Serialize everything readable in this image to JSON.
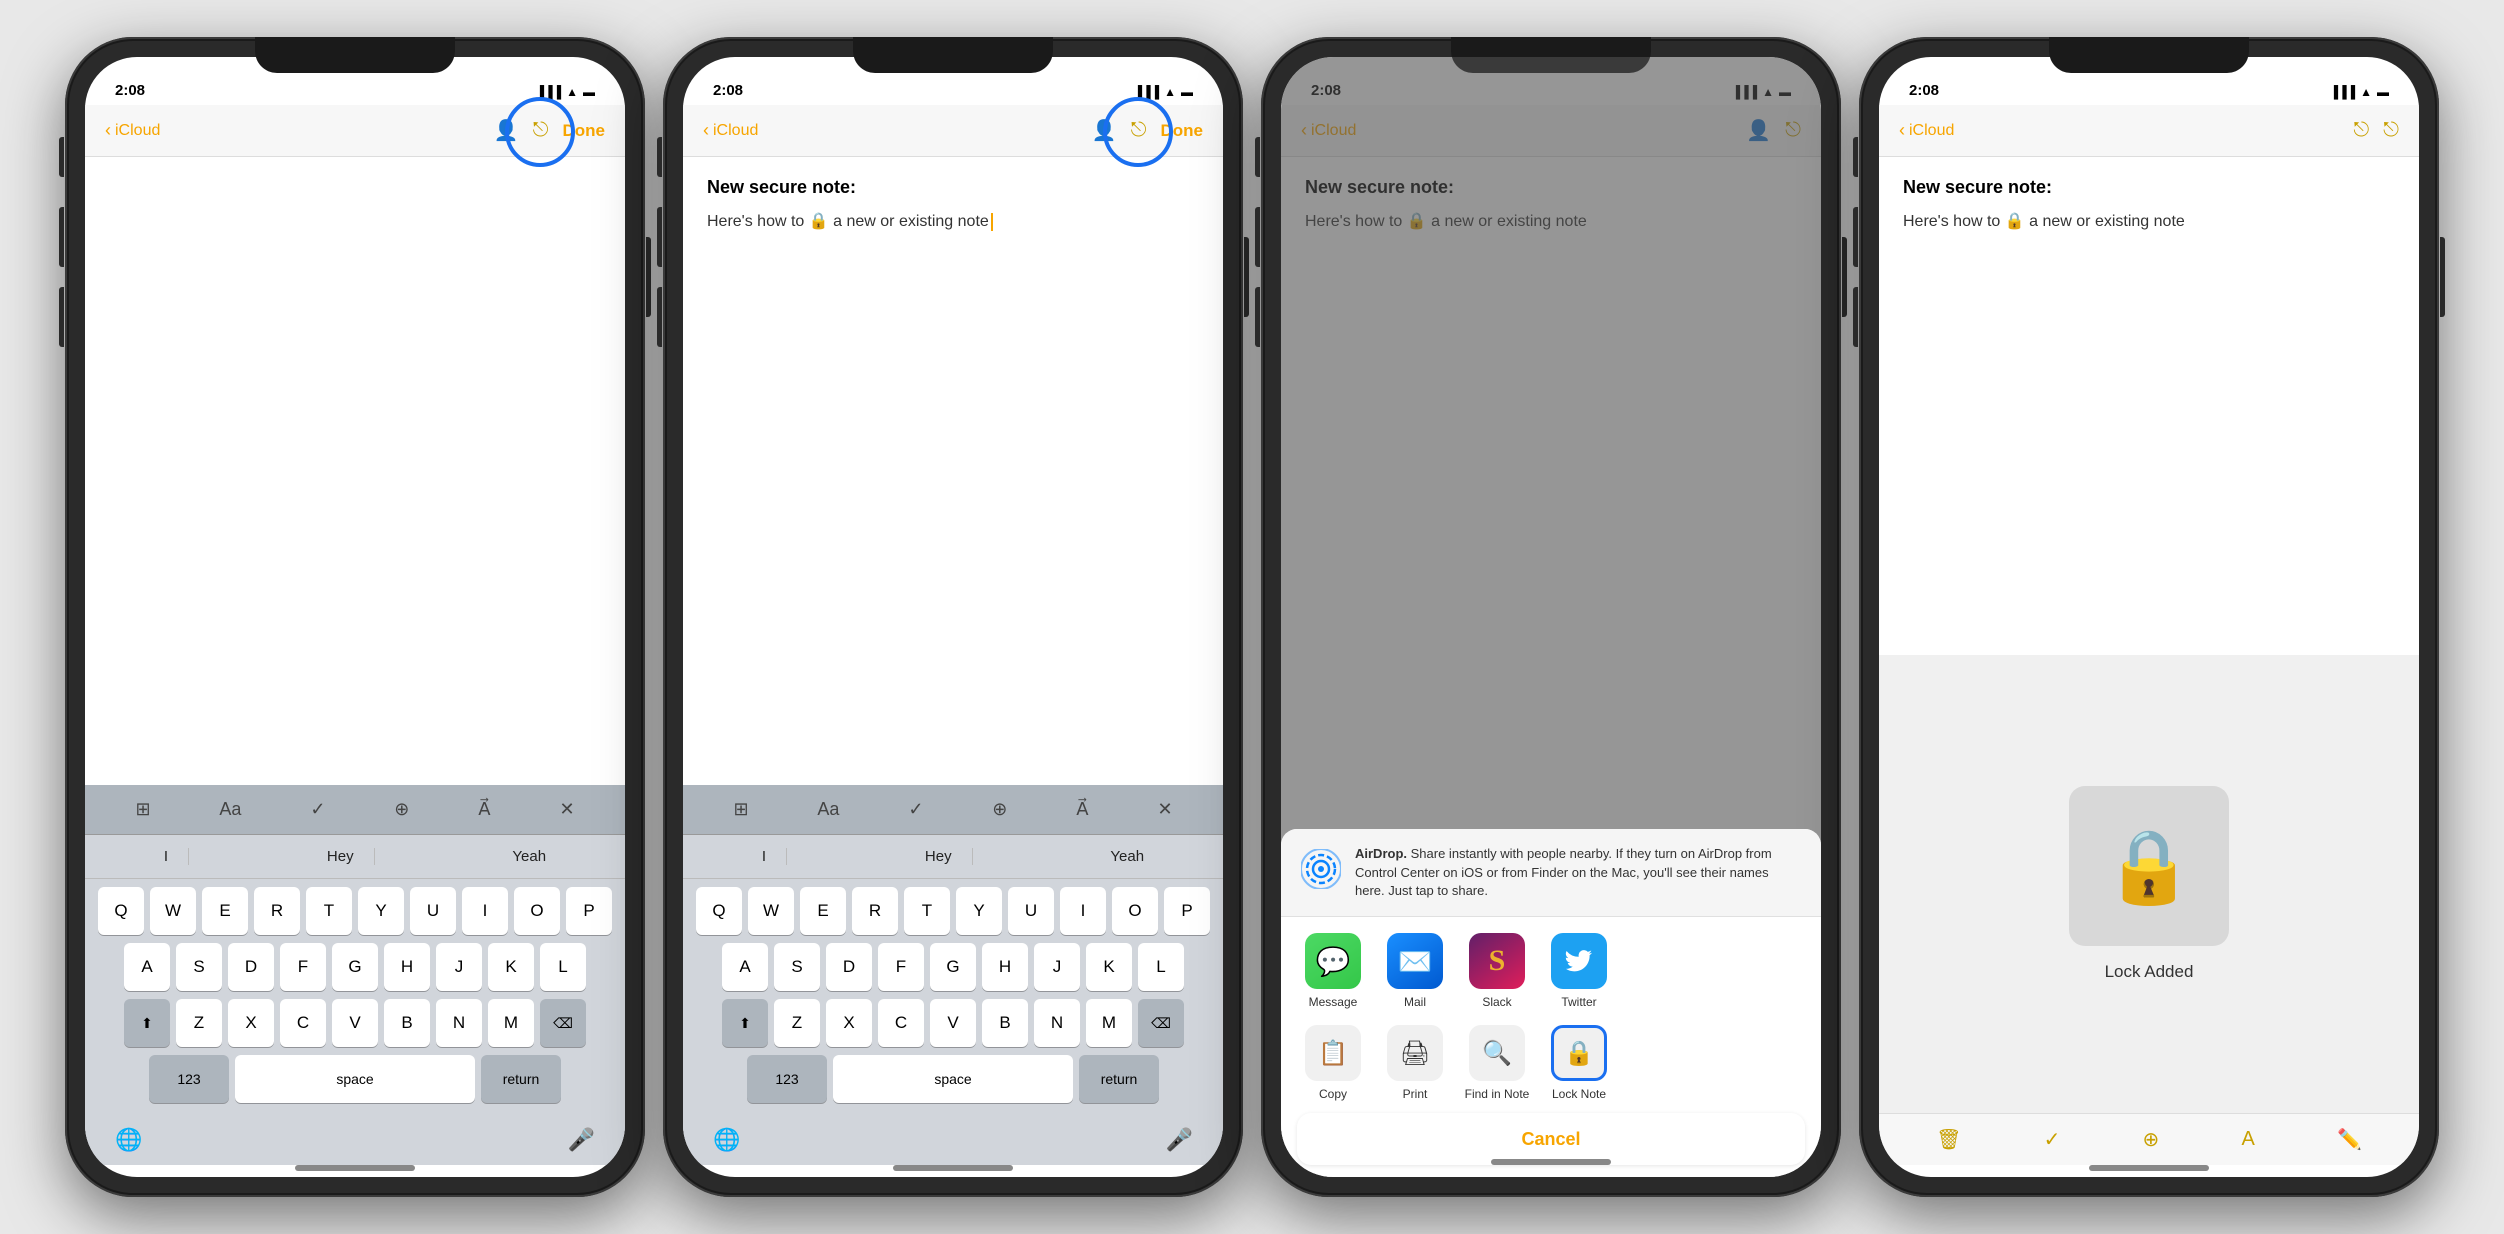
{
  "phones": [
    {
      "id": "phone1",
      "status": {
        "time": "2:08",
        "signal": "●●●●",
        "wifi": "WiFi",
        "battery": "🔋"
      },
      "nav": {
        "back": "iCloud",
        "done": "Done"
      },
      "note": {
        "title": "",
        "body": ""
      },
      "showKeyboard": true,
      "showBlueCircle": true,
      "blueCircle": "share-button",
      "highlightShare": true
    },
    {
      "id": "phone2",
      "status": {
        "time": "2:08",
        "signal": "●●●●",
        "wifi": "WiFi",
        "battery": "🔋"
      },
      "nav": {
        "back": "iCloud",
        "done": "Done"
      },
      "note": {
        "title": "New secure note:",
        "body": "Here's how to 🔒 a new or existing note"
      },
      "showKeyboard": true,
      "showBlueCircle": true,
      "blueCircle": "share-button",
      "highlightShare": true
    },
    {
      "id": "phone3",
      "status": {
        "time": "2:08",
        "signal": "●●●●",
        "wifi": "WiFi",
        "battery": "🔋"
      },
      "nav": {
        "back": "iCloud",
        "done": ""
      },
      "note": {
        "title": "New secure note:",
        "body": "Here's how to 🔒 a new or existing note"
      },
      "showKeyboard": false,
      "showShareSheet": true,
      "airdrop": {
        "title": "AirDrop.",
        "description": "Share instantly with people nearby. If they turn on AirDrop from Control Center on iOS or from Finder on the Mac, you'll see their names here. Just tap to share."
      },
      "shareApps": [
        {
          "label": "Message",
          "type": "message"
        },
        {
          "label": "Mail",
          "type": "mail"
        },
        {
          "label": "Slack",
          "type": "slack"
        },
        {
          "label": "Twitter",
          "type": "twitter"
        }
      ],
      "shareActions": [
        {
          "label": "Copy",
          "icon": "📋",
          "highlighted": false
        },
        {
          "label": "Print",
          "icon": "🖨",
          "highlighted": false
        },
        {
          "label": "Find in Note",
          "icon": "🔍",
          "highlighted": false
        },
        {
          "label": "Lock Note",
          "icon": "🔒",
          "highlighted": true
        }
      ],
      "cancel": "Cancel"
    },
    {
      "id": "phone4",
      "status": {
        "time": "2:08",
        "signal": "●●●●",
        "wifi": "WiFi",
        "battery": "🔋"
      },
      "nav": {
        "back": "iCloud",
        "done": ""
      },
      "note": {
        "title": "New secure note:",
        "body": "Here's how to 🔒 a new or existing note"
      },
      "showKeyboard": false,
      "showLockAdded": true,
      "lockAdded": "Lock Added"
    }
  ],
  "keyboard": {
    "toolbar": [
      "⊞",
      "Aa",
      "✓",
      "⊕",
      "A",
      "✕"
    ],
    "predictive": [
      "I",
      "Hey",
      "Yeah"
    ],
    "rows": [
      [
        "Q",
        "W",
        "E",
        "R",
        "T",
        "Y",
        "U",
        "I",
        "O",
        "P"
      ],
      [
        "A",
        "S",
        "D",
        "F",
        "G",
        "H",
        "J",
        "K",
        "L"
      ],
      [
        "⬆",
        "Z",
        "X",
        "C",
        "V",
        "B",
        "N",
        "M",
        "⌫"
      ],
      [
        "123",
        "space",
        "return"
      ]
    ]
  }
}
